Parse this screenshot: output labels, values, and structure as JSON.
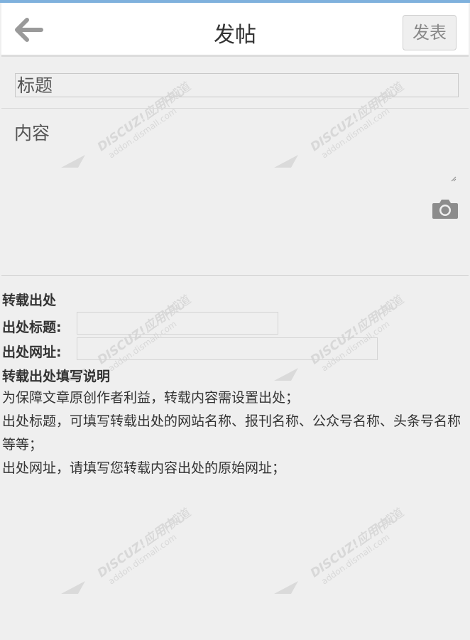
{
  "header": {
    "back_icon": "arrow-left-icon",
    "title": "发帖",
    "publish_label": "发表"
  },
  "form": {
    "title_placeholder": "标题",
    "content_placeholder": "内容",
    "camera_icon": "camera-icon"
  },
  "source": {
    "heading": "转载出处",
    "title_label": "出处标题:",
    "url_label": "出处网址:",
    "guide_title": "转载出处填写说明",
    "guide_lines": [
      "为保障文章原创作者利益，转载内容需设置出处；",
      "出处标题，可填写转载出处的网站名称、报刊名称、公众号名称、头条号名称等等；",
      "出处网址，请填写您转载内容出处的原始网址；"
    ]
  },
  "watermark": {
    "brand": "DISCUZ!应用中心",
    "divider": "|",
    "brand_cn": "贰道",
    "url": "addon.dismall.com"
  },
  "colors": {
    "background": "#efefef",
    "header_bg": "#ffffff",
    "top_accent": "#7fb1dd",
    "text": "#333333",
    "placeholder": "#555555"
  }
}
